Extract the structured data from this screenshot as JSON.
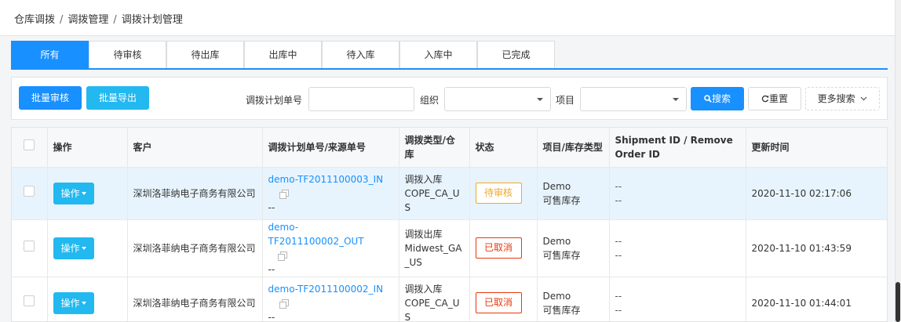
{
  "breadcrumb": [
    "仓库调拨",
    "调拨管理",
    "调拨计划管理"
  ],
  "breadcrumb_sep": "/",
  "tabs": [
    {
      "label": "所有",
      "active": true
    },
    {
      "label": "待审核"
    },
    {
      "label": "待出库"
    },
    {
      "label": "出库中"
    },
    {
      "label": "待入库"
    },
    {
      "label": "入库中"
    },
    {
      "label": "已完成"
    }
  ],
  "toolbar": {
    "batch_review": "批量审核",
    "batch_export": "批量导出",
    "plan_no_label": "调拨计划单号",
    "plan_no_value": "",
    "org_label": "组织",
    "org_value": "",
    "project_label": "项目",
    "project_value": "",
    "search": "搜索",
    "reset": "重置",
    "more_search": "更多搜索"
  },
  "table": {
    "columns": [
      "操作",
      "客户",
      "调拨计划单号/来源单号",
      "调拨类型/仓库",
      "状态",
      "项目/库存类型",
      "Shipment ID / Remove Order ID",
      "更新时间"
    ],
    "op_label": "操作",
    "rows": [
      {
        "customer": "深圳洛菲纳电子商务有限公司",
        "plan_no": "demo-TF2011100003_IN",
        "source_no": "--",
        "type": "调拨入库",
        "warehouse": "COPE_CA_US",
        "status": "待审核",
        "status_kind": "pending",
        "project": "Demo",
        "stock_type": "可售库存",
        "shipment_id": "--",
        "remove_id": "--",
        "updated": "2020-11-10 02:17:06",
        "highlight": true
      },
      {
        "customer": "深圳洛菲纳电子商务有限公司",
        "plan_no": "demo-TF2011100002_OUT",
        "source_no": "--",
        "type": "调拨出库",
        "warehouse": "Midwest_GA_US",
        "status": "已取消",
        "status_kind": "cancel",
        "project": "Demo",
        "stock_type": "可售库存",
        "shipment_id": "--",
        "remove_id": "--",
        "updated": "2020-11-10 01:43:59",
        "highlight": false
      },
      {
        "customer": "深圳洛菲纳电子商务有限公司",
        "plan_no": "demo-TF2011100002_IN",
        "source_no": "--",
        "type": "调拨入库",
        "warehouse": "COPE_CA_US",
        "status": "已取消",
        "status_kind": "cancel",
        "project": "Demo",
        "stock_type": "可售库存",
        "shipment_id": "--",
        "remove_id": "--",
        "updated": "2020-11-10 01:44:01",
        "highlight": false
      }
    ]
  },
  "colors": {
    "primary": "#1890ff",
    "cyan": "#22b8f0",
    "pending": "#f5a623",
    "cancel": "#e8380d",
    "row_highlight": "#e8f4fd"
  },
  "icons": [
    "search-icon",
    "refresh-icon",
    "chevron-down-icon",
    "copy-icon",
    "caret-down-icon"
  ]
}
